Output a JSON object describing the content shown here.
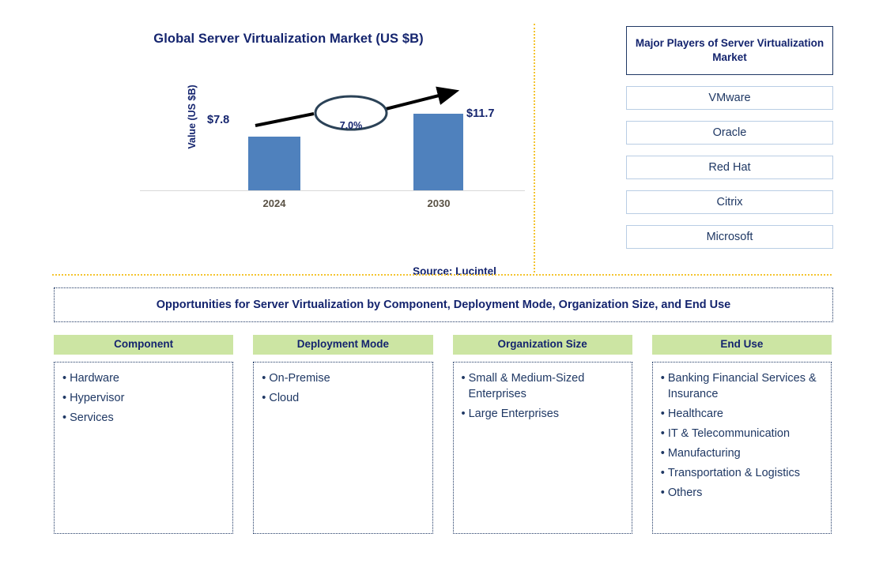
{
  "chart": {
    "title": "Global Server Virtualization Market (US $B)",
    "ylabel": "Value (US $B)",
    "cagr": "7.0%",
    "source": "Source: Lucintel",
    "value_2024": "$7.8",
    "value_2030": "$11.7",
    "tick_2024": "2024",
    "tick_2030": "2030"
  },
  "chart_data": {
    "type": "bar",
    "title": "Global Server Virtualization Market (US $B)",
    "xlabel": "",
    "ylabel": "Value (US $B)",
    "categories": [
      "2024",
      "2030"
    ],
    "values": [
      7.8,
      11.7
    ],
    "data_labels": [
      "$7.8",
      "$11.7"
    ],
    "ylim": [
      0,
      13
    ],
    "grid": false,
    "legend": "none",
    "annotations": [
      {
        "text": "7.0%",
        "type": "cagr-ellipse",
        "between": [
          "2024",
          "2030"
        ]
      }
    ],
    "series_color": "#4f81bd",
    "source": "Source: Lucintel"
  },
  "players": {
    "header": "Major Players of Server Virtualization Market",
    "items": [
      "VMware",
      "Oracle",
      "Red Hat",
      "Citrix",
      "Microsoft"
    ]
  },
  "banner": {
    "title": "Opportunities for Server Virtualization by Component, Deployment Mode, Organization Size, and End Use"
  },
  "categories": [
    {
      "header": "Component",
      "items": [
        "Hardware",
        "Hypervisor",
        "Services"
      ]
    },
    {
      "header": "Deployment Mode",
      "items": [
        "On-Premise",
        "Cloud"
      ]
    },
    {
      "header": "Organization Size",
      "items": [
        "Small & Medium-Sized Enterprises",
        "Large Enterprises"
      ]
    },
    {
      "header": "End Use",
      "items": [
        "Banking Financial Services & Insurance",
        "Healthcare",
        "IT & Telecommunication",
        "Manufacturing",
        "Transportation & Logistics",
        "Others"
      ]
    }
  ],
  "colors": {
    "bar": "#4f81bd",
    "navy": "#14246e",
    "header_green": "#cce5a3",
    "divider_gold": "#f4c430",
    "player_border": "#b9cde4"
  }
}
